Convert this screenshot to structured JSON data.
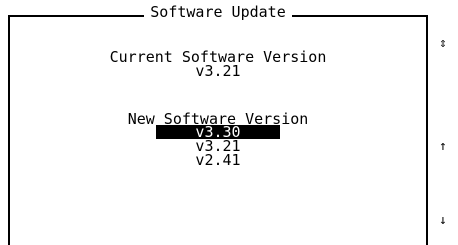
{
  "dialog": {
    "title": "Software Update"
  },
  "current": {
    "label": "Current Software Version",
    "value": "v3.21"
  },
  "new": {
    "label": "New Software Version",
    "versions": [
      {
        "label": "v3.30",
        "selected": true
      },
      {
        "label": "v3.21",
        "selected": false
      },
      {
        "label": "v2.41",
        "selected": false
      }
    ]
  },
  "side_indicators": {
    "scroll_both": "⇕",
    "scroll_up": "↑",
    "scroll_down": "↓"
  },
  "colors": {
    "background": "#ffffff",
    "text": "#000000",
    "highlight_bg": "#000000",
    "highlight_text": "#ffffff"
  },
  "icons": {
    "scroll_both": "up-down-arrow-icon",
    "scroll_up": "up-arrow-icon",
    "scroll_down": "down-arrow-icon"
  }
}
